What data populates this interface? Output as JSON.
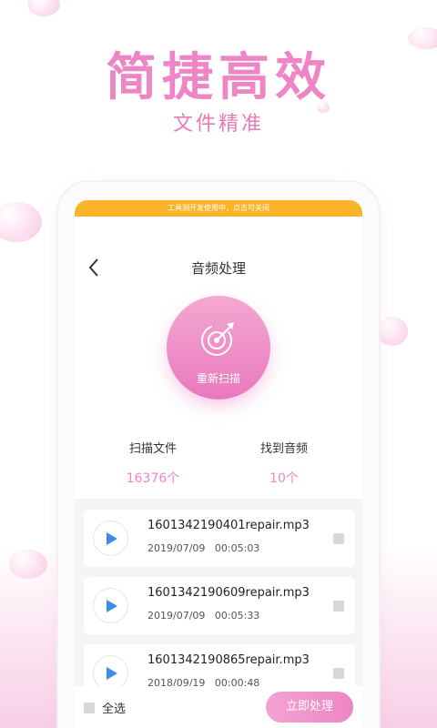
{
  "promo": {
    "headline": "简捷高效",
    "subline": "文件精准"
  },
  "notice": "工具测开发使用中，点击可关闭",
  "nav": {
    "title": "音频处理"
  },
  "scan": {
    "label": "重新扫描"
  },
  "stats": [
    {
      "label": "扫描文件",
      "value": "16376个"
    },
    {
      "label": "找到音频",
      "value": "10个"
    }
  ],
  "files": [
    {
      "name": "1601342190401repair.mp3",
      "date": "2019/07/09",
      "duration": "00:05:03"
    },
    {
      "name": "1601342190609repair.mp3",
      "date": "2019/07/09",
      "duration": "00:05:33"
    },
    {
      "name": "1601342190865repair.mp3",
      "date": "2018/09/19",
      "duration": "00:00:48"
    }
  ],
  "bottom": {
    "select_all": "全选",
    "process": "立即处理"
  },
  "colors": {
    "accent": "#ee85c4",
    "notice": "#fbb42a",
    "play": "#3b8ee8"
  }
}
